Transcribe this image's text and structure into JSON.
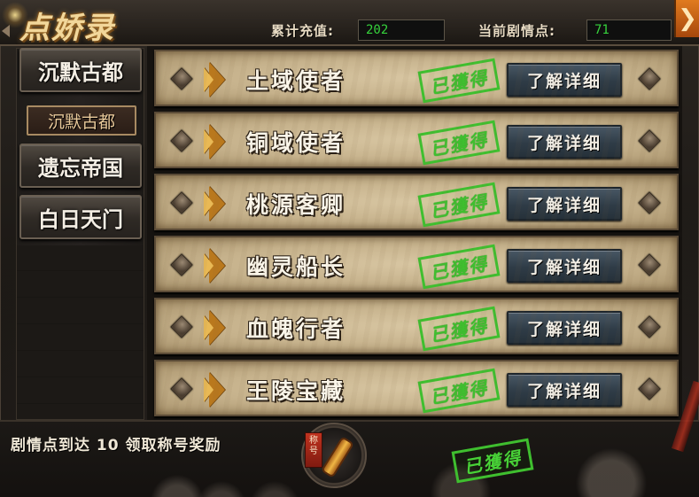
{
  "header": {
    "title": "点娇录",
    "recharge_label": "累计充值:",
    "recharge_value": "202",
    "plot_points_label": "当前剧情点:",
    "plot_points_value": "71"
  },
  "sidebar": {
    "items": [
      {
        "label": "沉默古都"
      },
      {
        "label": "沉默古都"
      },
      {
        "label": "遗忘帝国"
      },
      {
        "label": "白日天门"
      }
    ]
  },
  "rows": [
    {
      "title": "土域使者",
      "status": "已獲得",
      "button": "了解详细"
    },
    {
      "title": "铜域使者",
      "status": "已獲得",
      "button": "了解详细"
    },
    {
      "title": "桃源客卿",
      "status": "已獲得",
      "button": "了解详细"
    },
    {
      "title": "幽灵船长",
      "status": "已獲得",
      "button": "了解详细"
    },
    {
      "title": "血魄行者",
      "status": "已獲得",
      "button": "了解详细"
    },
    {
      "title": "王陵宝藏",
      "status": "已獲得",
      "button": "了解详细"
    }
  ],
  "footer": {
    "reward_text": "剧情点到达  10 领取称号奖励",
    "reward_tag": "称号",
    "reward_status": "已獲得"
  },
  "colors": {
    "value_text": "#36d23c",
    "stamp": "#3fbf2f",
    "close_button": "#e07b1f"
  },
  "icons": {
    "close": "chevron-right-icon",
    "row_left": "diamond-gem-icon",
    "row_chevron": "gold-chevron-icon",
    "reward": "scroll-icon"
  }
}
